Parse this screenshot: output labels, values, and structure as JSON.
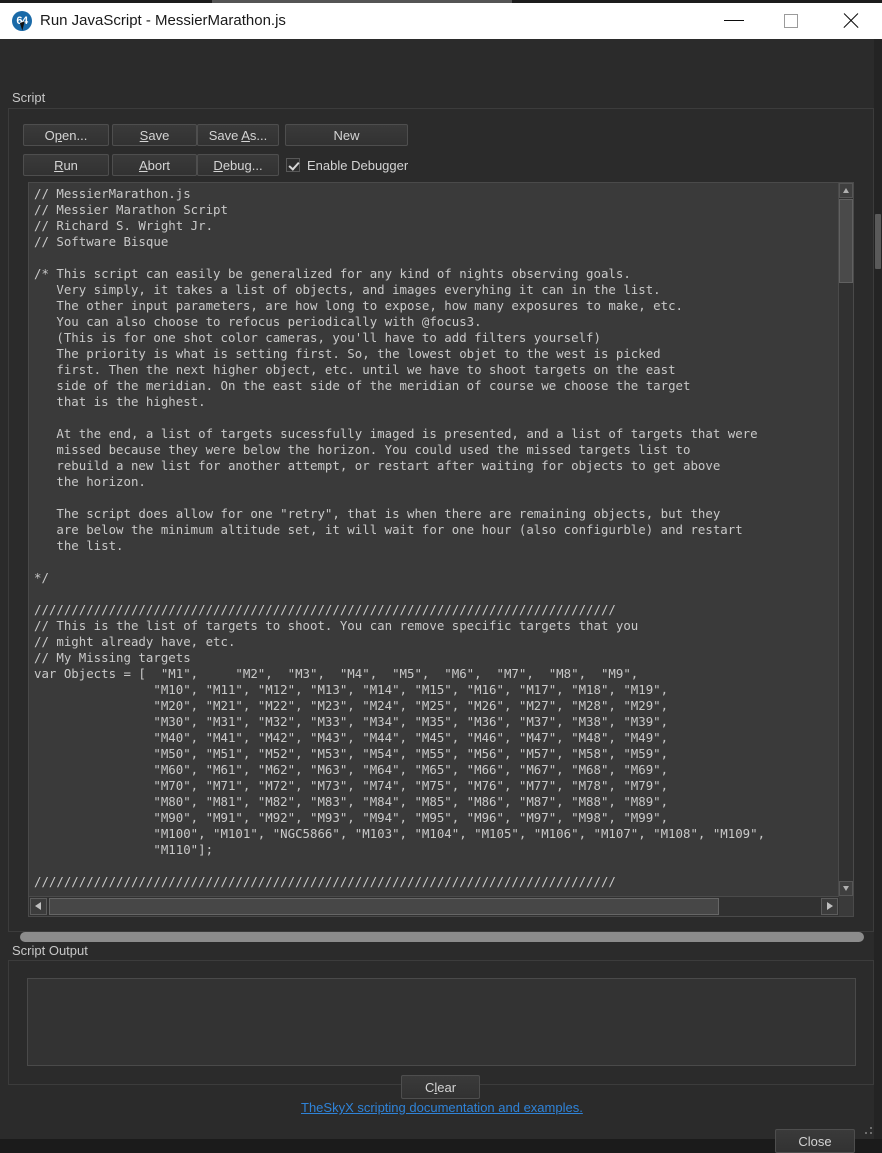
{
  "window": {
    "title": "Run JavaScript - MessierMarathon.js",
    "app_icon_label": "64",
    "minimize_label": "Minimize",
    "maximize_label": "Maximize",
    "close_label": "Close"
  },
  "script_group": {
    "label": "Script",
    "buttons": {
      "open": {
        "pre": "O",
        "acc": "p",
        "post": "en..."
      },
      "save": {
        "pre": "",
        "acc": "S",
        "post": "ave"
      },
      "save_as": {
        "pre": "Save ",
        "acc": "A",
        "post": "s..."
      },
      "new": {
        "pre": "New",
        "acc": "",
        "post": ""
      },
      "run": {
        "pre": "",
        "acc": "R",
        "post": "un"
      },
      "abort": {
        "pre": "",
        "acc": "A",
        "post": "bort"
      },
      "debug": {
        "pre": "",
        "acc": "D",
        "post": "ebug..."
      }
    },
    "enable_debugger": {
      "pre": "",
      "acc": "E",
      "post": "nable Debugger",
      "checked": true,
      "full_label": "Enable Debugger"
    },
    "code": "// MessierMarathon.js\n// Messier Marathon Script\n// Richard S. Wright Jr.\n// Software Bisque\n\n/* This script can easily be generalized for any kind of nights observing goals.\n   Very simply, it takes a list of objects, and images everyhing it can in the list.\n   The other input parameters, are how long to expose, how many exposures to make, etc.\n   You can also choose to refocus periodically with @focus3.\n   (This is for one shot color cameras, you'll have to add filters yourself)\n   The priority is what is setting first. So, the lowest objet to the west is picked\n   first. Then the next higher object, etc. until we have to shoot targets on the east\n   side of the meridian. On the east side of the meridian of course we choose the target\n   that is the highest.\n\n   At the end, a list of targets sucessfully imaged is presented, and a list of targets that were\n   missed because they were below the horizon. You could used the missed targets list to\n   rebuild a new list for another attempt, or restart after waiting for objects to get above\n   the horizon.\n\n   The script does allow for one \"retry\", that is when there are remaining objects, but they\n   are below the minimum altitude set, it will wait for one hour (also configurble) and restart\n   the list.\n\n*/\n\n//////////////////////////////////////////////////////////////////////////////\n// This is the list of targets to shoot. You can remove specific targets that you\n// might already have, etc.\n// My Missing targets\nvar Objects = [  \"M1\",     \"M2\",  \"M3\",  \"M4\",  \"M5\",  \"M6\",  \"M7\",  \"M8\",  \"M9\",\n                \"M10\", \"M11\", \"M12\", \"M13\", \"M14\", \"M15\", \"M16\", \"M17\", \"M18\", \"M19\",\n                \"M20\", \"M21\", \"M22\", \"M23\", \"M24\", \"M25\", \"M26\", \"M27\", \"M28\", \"M29\",\n                \"M30\", \"M31\", \"M32\", \"M33\", \"M34\", \"M35\", \"M36\", \"M37\", \"M38\", \"M39\",\n                \"M40\", \"M41\", \"M42\", \"M43\", \"M44\", \"M45\", \"M46\", \"M47\", \"M48\", \"M49\",\n                \"M50\", \"M51\", \"M52\", \"M53\", \"M54\", \"M55\", \"M56\", \"M57\", \"M58\", \"M59\",\n                \"M60\", \"M61\", \"M62\", \"M63\", \"M64\", \"M65\", \"M66\", \"M67\", \"M68\", \"M69\",\n                \"M70\", \"M71\", \"M72\", \"M73\", \"M74\", \"M75\", \"M76\", \"M77\", \"M78\", \"M79\",\n                \"M80\", \"M81\", \"M82\", \"M83\", \"M84\", \"M85\", \"M86\", \"M87\", \"M88\", \"M89\",\n                \"M90\", \"M91\", \"M92\", \"M93\", \"M94\", \"M95\", \"M96\", \"M97\", \"M98\", \"M99\",\n                \"M100\", \"M101\", \"NGC5866\", \"M103\", \"M104\", \"M105\", \"M106\", \"M107\", \"M108\", \"M109\",\n                \"M110\"];\n\n//////////////////////////////////////////////////////////////////////////////"
  },
  "output_group": {
    "label": "Script Output",
    "text": ""
  },
  "footer": {
    "clear": {
      "pre": "C",
      "acc": "l",
      "post": "ear"
    },
    "doc_link": "TheSkyX scripting documentation and examples.",
    "close": "Close"
  },
  "colors": {
    "window_bg": "#2b2b2b",
    "editor_bg": "#3a3a3a",
    "code_text": "#c9c9c9",
    "link": "#2f83d8",
    "titlebar_bg": "#ffffff",
    "icon_blue": "#1a6aa8"
  }
}
